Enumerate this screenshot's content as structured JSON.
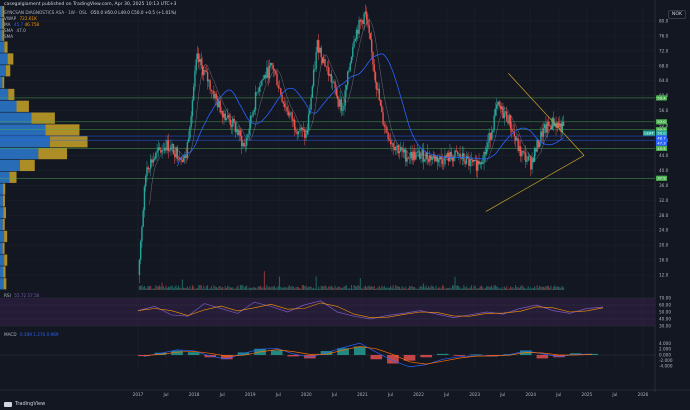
{
  "header": {
    "publisher_line": "casegalgiament published on TradingView.com, Apr 30, 2025 10:13 UTC+3",
    "currency": "NOK"
  },
  "legend": {
    "title_line": "SYNCSAN DIAGNOSTICS ASA · 1W · OSL",
    "ohlc": "O50.0 H50.0 L49.0 C50.0 +0.5 (+1.01%)",
    "vwap_label": "VWAP",
    "vwap_value": "722.61K",
    "ma_label": "MA",
    "ma_value": "45.7",
    "ma2_value": "46.758",
    "sma_label": "SMA",
    "sma_value": "47.0",
    "sma2_label": "SMA"
  },
  "bottom_labels": {
    "rsi": "RSI",
    "rsi_values": "55.72 57.56",
    "macd": "MACD",
    "macd_values": "0.309 1.276 0.969",
    "brand": "TradingView"
  },
  "colors": {
    "background": "#131722",
    "grid": "#1e222d",
    "up": "#26a69a",
    "down": "#ef5350",
    "ma_blue": "#2962ff",
    "ma_light": "#b2b5be",
    "trend": "#c9a227",
    "hline_green": "#4caf50",
    "hline_blue": "#2962ff",
    "vp_blue": "#2d7bd1",
    "vp_gold": "#c9a227",
    "rsi_line": "#7e57c2",
    "rsi_signal": "#ff9800",
    "rsi_band": "#2a1f3d",
    "macd_line": "#2962ff",
    "signal_line": "#ff6d00"
  },
  "chart_data": [
    {
      "type": "candlestick",
      "name": "price",
      "x": [
        "2017",
        "Jul",
        "2018",
        "Jul",
        "2019",
        "Jul",
        "2020",
        "Jul",
        "2021",
        "Jul",
        "2022",
        "Jul",
        "2023",
        "Jul",
        "2024",
        "Jul",
        "2025",
        "Jul",
        "2026"
      ],
      "ylim": [
        8,
        84
      ],
      "y_ticks": [
        "80.0",
        "76.0",
        "72.0",
        "68.0",
        "64.0",
        "60.0",
        "56.0",
        "52.0",
        "48.0",
        "44.0",
        "40.0",
        "36.0",
        "32.0",
        "28.0",
        "24.0",
        "20.0",
        "16.0",
        "12.0"
      ],
      "path_points": [
        [
          0,
          12
        ],
        [
          0.3,
          41
        ],
        [
          1.0,
          47
        ],
        [
          1.7,
          43
        ],
        [
          2.1,
          70
        ],
        [
          2.5,
          64
        ],
        [
          2.9,
          57
        ],
        [
          3.5,
          51
        ],
        [
          3.8,
          46
        ],
        [
          4.3,
          63
        ],
        [
          4.8,
          68
        ],
        [
          5.2,
          58
        ],
        [
          5.6,
          52
        ],
        [
          6.0,
          49
        ],
        [
          6.4,
          74
        ],
        [
          6.9,
          64
        ],
        [
          7.3,
          56
        ],
        [
          7.7,
          76
        ],
        [
          8.1,
          82
        ],
        [
          8.4,
          68
        ],
        [
          8.7,
          54
        ],
        [
          9.0,
          48
        ],
        [
          9.5,
          44
        ],
        [
          10.2,
          44
        ],
        [
          10.8,
          43
        ],
        [
          11.4,
          44
        ],
        [
          12.0,
          41
        ],
        [
          12.4,
          45
        ],
        [
          12.8,
          57
        ],
        [
          13.2,
          54
        ],
        [
          13.6,
          45
        ],
        [
          14.0,
          42
        ],
        [
          14.4,
          50
        ],
        [
          14.8,
          53
        ],
        [
          15.2,
          51
        ]
      ],
      "horizontal_levels": [
        {
          "value": "59.4",
          "color": "green"
        },
        {
          "value": "53.0",
          "color": "green"
        },
        {
          "value": "50.9",
          "color": "green"
        },
        {
          "value": "49.2",
          "color": "blue"
        },
        {
          "value": "48.1",
          "color": "blue"
        },
        {
          "value": "45.9",
          "color": "green"
        },
        {
          "value": "37.9",
          "color": "green"
        }
      ],
      "price_tags": [
        {
          "label": "LEAT",
          "value": "50.0",
          "color": "#26a69a"
        },
        {
          "value": "48.7",
          "color": "#2962ff"
        },
        {
          "value": "47.3",
          "color": "#2962ff"
        }
      ],
      "triangle": {
        "apex_x": 15.9,
        "apex_y": 44,
        "upper_start": [
          13.2,
          66
        ],
        "lower_start": [
          12.4,
          29
        ]
      },
      "annotations": [
        "Horizontal volume profile on left",
        "Symmetrical triangle drawn 2023-2025"
      ]
    },
    {
      "type": "line",
      "name": "RSI",
      "ylim": [
        30,
        70
      ],
      "y_ticks": [
        "70.00",
        "60.00",
        "50.00",
        "40.00",
        "30.00"
      ],
      "bands": [
        70,
        30
      ],
      "values": [
        52,
        58,
        46,
        44,
        62,
        55,
        48,
        64,
        58,
        50,
        60,
        66,
        50,
        44,
        40,
        45,
        48,
        52,
        47,
        42,
        46,
        50,
        47,
        55,
        60,
        52,
        48,
        55,
        57
      ]
    },
    {
      "type": "bar",
      "name": "MACD",
      "ylim": [
        -6,
        6
      ],
      "y_ticks": [
        "4.000",
        "2.000",
        "0.000",
        "-2.000",
        "-4.000"
      ],
      "hist": [
        -0.4,
        0.8,
        1.5,
        1.0,
        -0.8,
        -1.5,
        0.9,
        2.2,
        1.6,
        -0.5,
        -1.2,
        1.4,
        2.4,
        3.0,
        -1.5,
        -3.0,
        -2.0,
        -0.8,
        0.4,
        -0.3,
        0.2,
        -0.5,
        0.3,
        1.6,
        -1.2,
        -0.8,
        0.6,
        0.4
      ],
      "macd": [
        -0.5,
        0.6,
        1.8,
        1.5,
        -0.4,
        -1.4,
        0.6,
        2.0,
        2.4,
        0.4,
        -0.8,
        0.8,
        2.6,
        4.2,
        1.0,
        -2.0,
        -4.2,
        -3.4,
        -1.5,
        -0.6,
        -0.2,
        -0.4,
        0.1,
        1.5,
        0.4,
        -0.6,
        0.2,
        0.3
      ],
      "signal": [
        -0.2,
        0.2,
        1.0,
        1.3,
        0.6,
        -0.4,
        -0.1,
        1.1,
        1.9,
        1.2,
        0.2,
        0.3,
        1.7,
        3.0,
        2.2,
        0.2,
        -2.4,
        -3.2,
        -2.2,
        -1.1,
        -0.4,
        -0.3,
        -0.1,
        0.9,
        0.7,
        0.0,
        0.0,
        0.2
      ]
    }
  ]
}
